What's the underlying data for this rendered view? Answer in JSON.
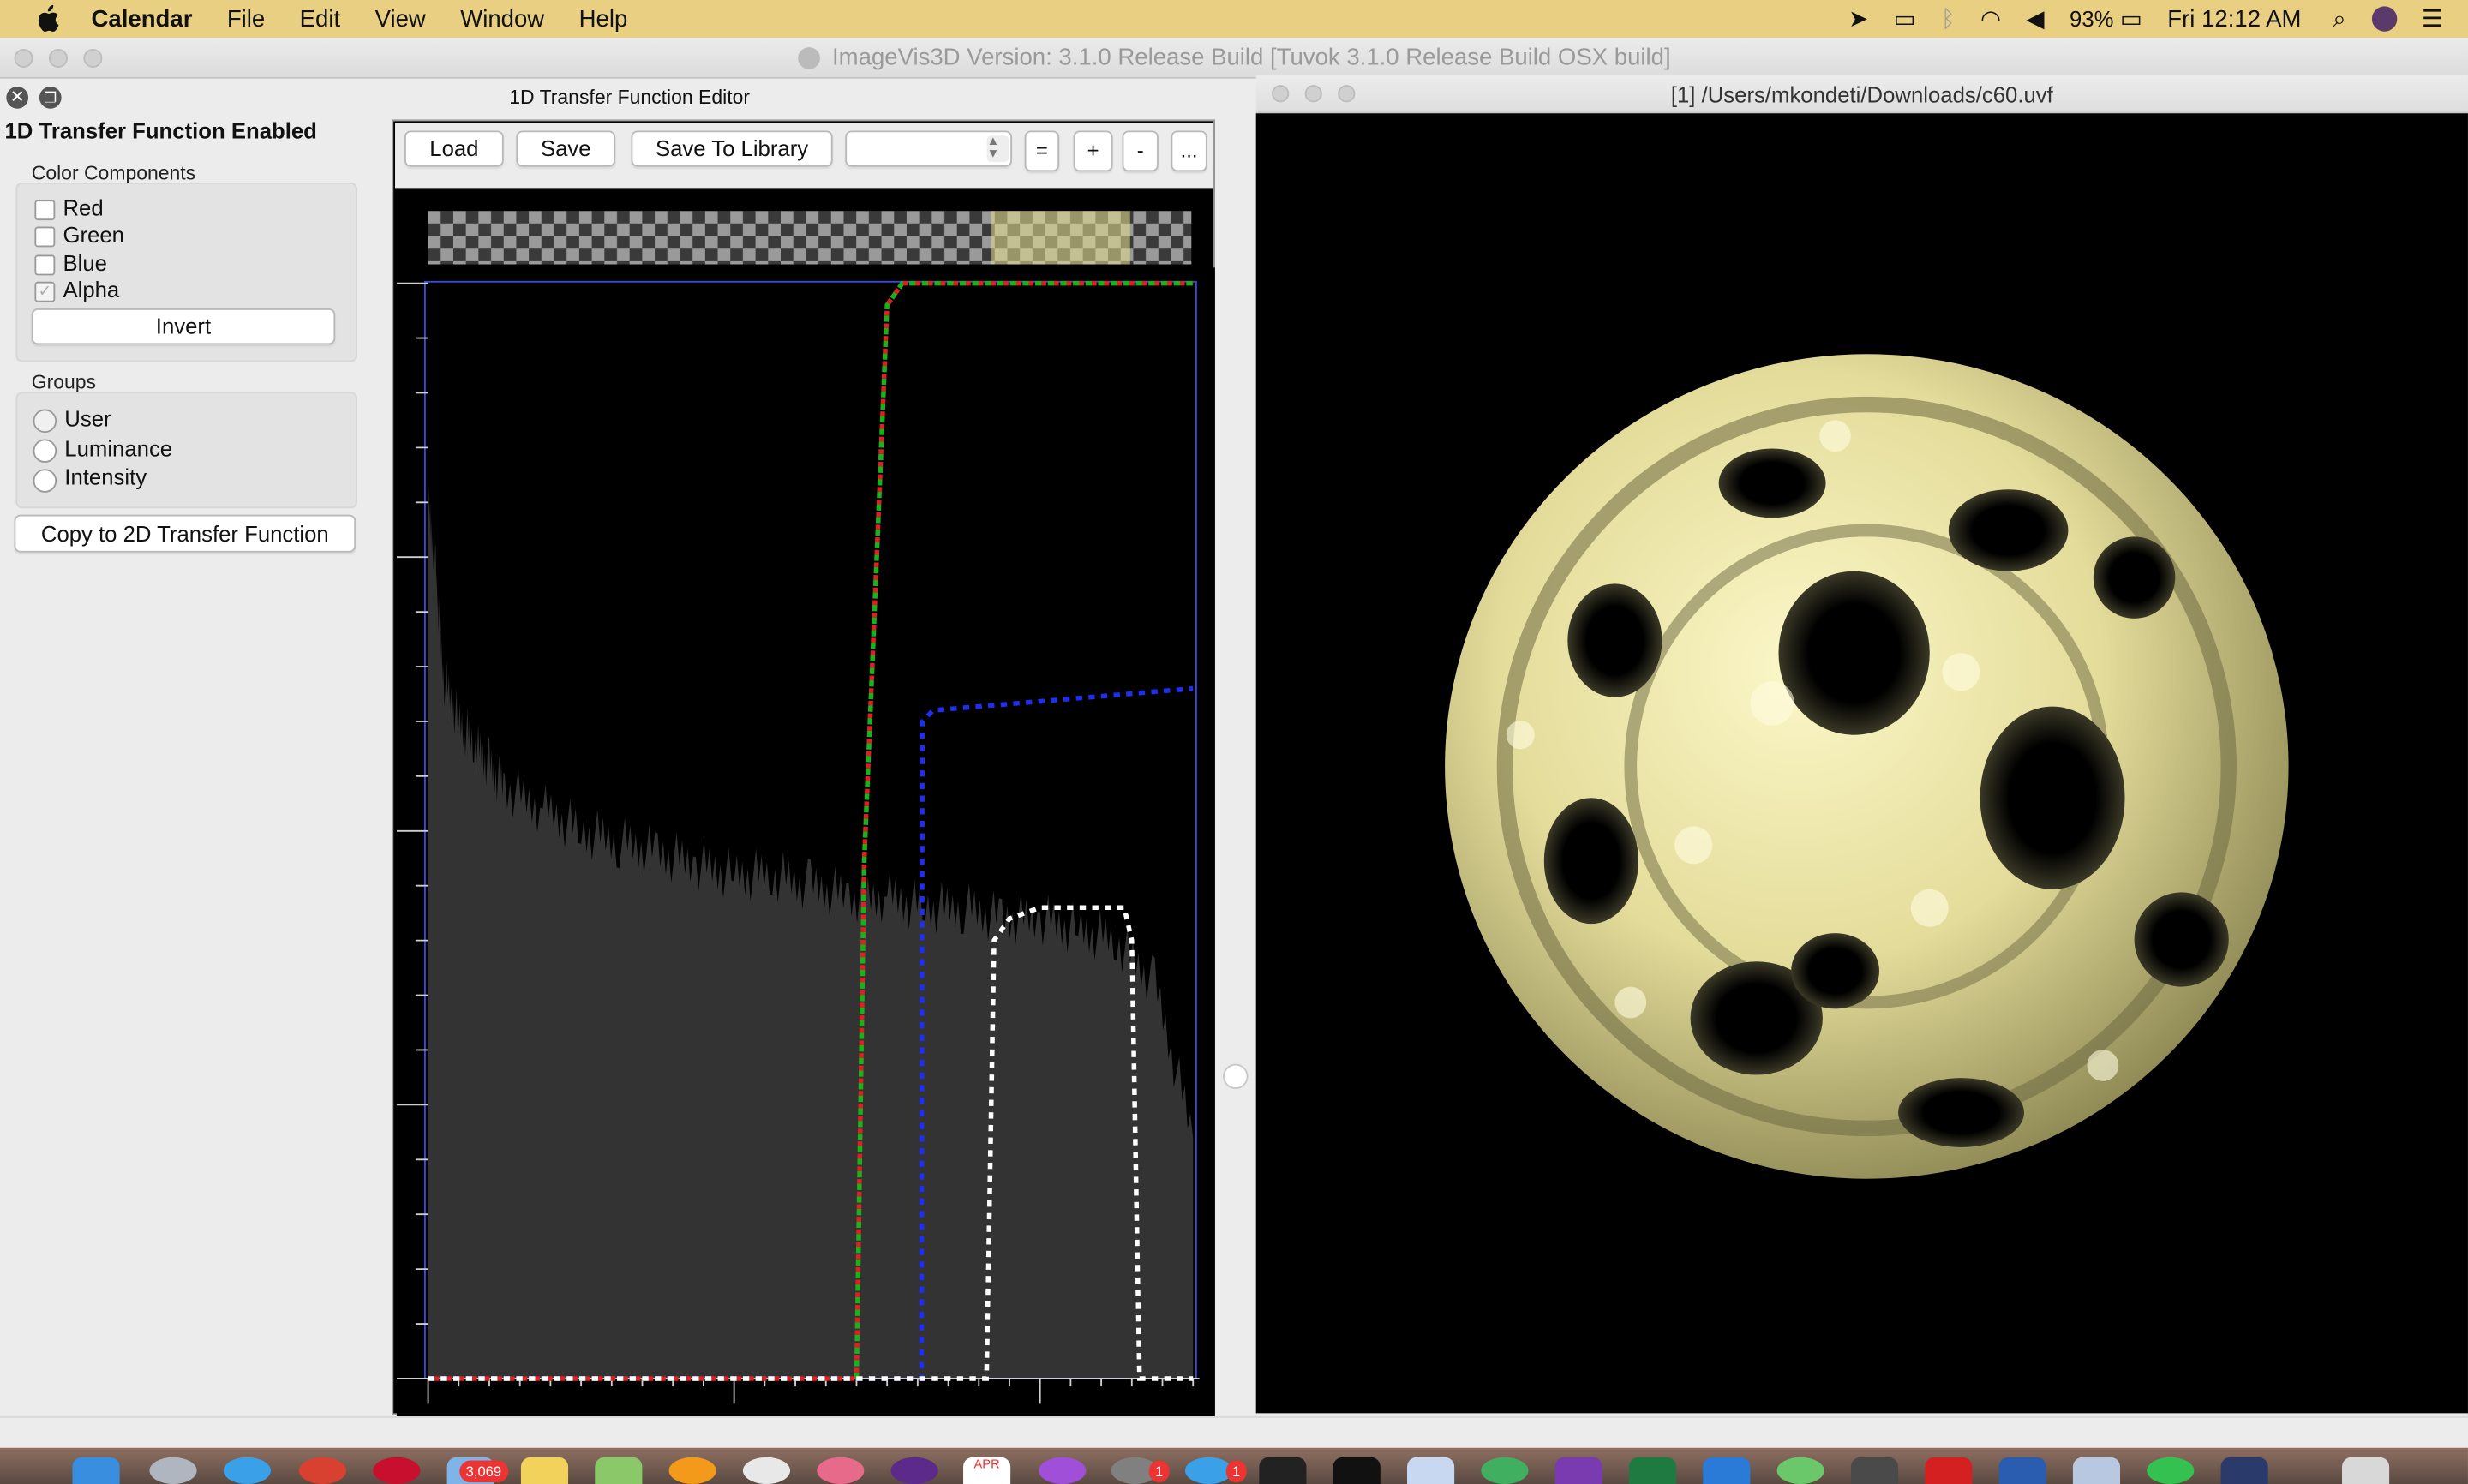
{
  "menubar": {
    "app_name": "Calendar",
    "items": [
      "File",
      "Edit",
      "View",
      "Window",
      "Help"
    ],
    "battery": "93%",
    "clock": "Fri 12:12 AM"
  },
  "main_window": {
    "title": "ImageVis3D Version: 3.1.0 Release Build [Tuvok 3.1.0 Release Build OSX build]"
  },
  "transfer_editor": {
    "title": "1D Transfer Function Editor",
    "enabled_label": "1D Transfer Function Enabled",
    "color_components": {
      "heading": "Color Components",
      "items": [
        {
          "label": "Red",
          "checked": false
        },
        {
          "label": "Green",
          "checked": false
        },
        {
          "label": "Blue",
          "checked": false
        },
        {
          "label": "Alpha",
          "checked": true
        }
      ],
      "invert_label": "Invert"
    },
    "groups": {
      "heading": "Groups",
      "items": [
        {
          "label": "User",
          "selected": true
        },
        {
          "label": "Luminance",
          "selected": false
        },
        {
          "label": "Intensity",
          "selected": false
        }
      ]
    },
    "copy_button_label": "Copy to 2D Transfer Function",
    "toolbar": {
      "load_label": "Load",
      "save_label": "Save",
      "save_library_label": "Save To Library",
      "preset_value": "",
      "equal_label": "=",
      "plus_label": "+",
      "minus_label": "-",
      "more_label": "..."
    }
  },
  "render_window": {
    "title": "[1] /Users/mkondeti/Downloads/c60.uvf"
  },
  "dock": {
    "mail_badge": "3,069",
    "badge_a": "1",
    "badge_b": "1",
    "calendar_month": "APR"
  },
  "chart_data": {
    "type": "line",
    "title": "",
    "xlabel": "",
    "ylabel": "",
    "xlim": [
      0,
      1
    ],
    "ylim": [
      0,
      1
    ],
    "histogram": {
      "x": [
        0.0,
        0.01,
        0.02,
        0.04,
        0.06,
        0.08,
        0.1,
        0.15,
        0.2,
        0.25,
        0.3,
        0.35,
        0.4,
        0.45,
        0.5,
        0.55,
        0.6,
        0.65,
        0.7,
        0.75,
        0.8,
        0.85,
        0.9,
        0.95,
        1.0
      ],
      "y": [
        0.8,
        0.74,
        0.64,
        0.6,
        0.58,
        0.56,
        0.54,
        0.52,
        0.5,
        0.49,
        0.48,
        0.47,
        0.46,
        0.46,
        0.45,
        0.44,
        0.44,
        0.43,
        0.43,
        0.42,
        0.42,
        0.41,
        0.4,
        0.36,
        0.22
      ]
    },
    "series": [
      {
        "color": "#19b219",
        "x": [
          0,
          0.56,
          0.57,
          0.6,
          0.62,
          1.0
        ],
        "y": [
          0,
          0,
          0.47,
          0.98,
          1.0,
          1.0
        ]
      },
      {
        "color": "#e02020",
        "x": [
          0,
          0.56,
          0.57,
          0.6,
          0.62,
          1.0
        ],
        "y": [
          0,
          0,
          0.47,
          0.98,
          1.0,
          1.0
        ]
      },
      {
        "color": "#1f2ef0",
        "x": [
          0,
          0.54,
          0.645,
          0.646,
          0.66,
          1.0
        ],
        "y": [
          0.0,
          0.0,
          0.0,
          0.6,
          0.61,
          0.63
        ]
      },
      {
        "color": "#ffffff",
        "x": [
          0,
          0.73,
          0.74,
          0.76,
          0.8,
          0.91,
          0.92,
          0.93,
          1.0
        ],
        "y": [
          0.0,
          0.0,
          0.4,
          0.42,
          0.43,
          0.43,
          0.4,
          0.0,
          0.0
        ]
      }
    ]
  }
}
